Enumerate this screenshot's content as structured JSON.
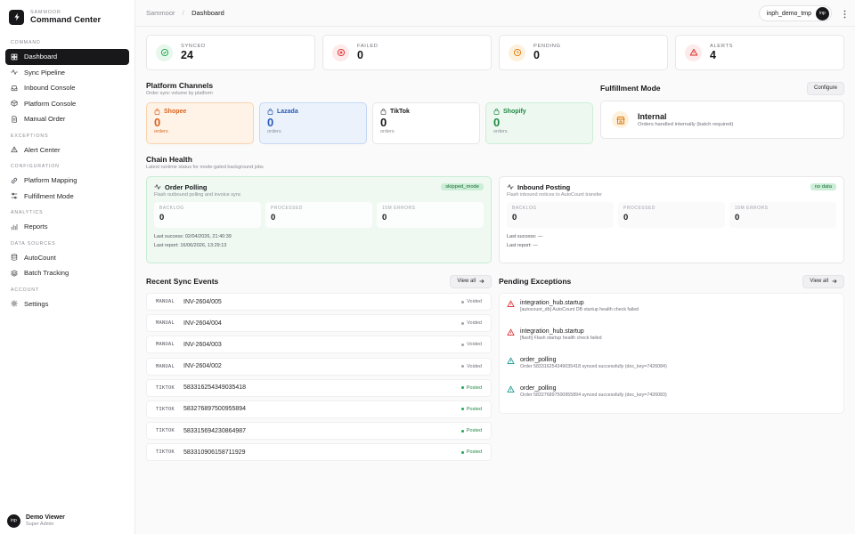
{
  "brand": {
    "small": "SAMMOOR",
    "name": "Command Center"
  },
  "nav": [
    {
      "section": "COMMAND",
      "items": [
        {
          "name": "dashboard",
          "label": "Dashboard",
          "icon": "grid-icon",
          "active": true
        },
        {
          "name": "sync-pipeline",
          "label": "Sync Pipeline",
          "icon": "pulse-icon"
        },
        {
          "name": "inbound-console",
          "label": "Inbound Console",
          "icon": "inbox-icon"
        },
        {
          "name": "platform-console",
          "label": "Platform Console",
          "icon": "box-icon"
        },
        {
          "name": "manual-order",
          "label": "Manual Order",
          "icon": "document-icon"
        }
      ]
    },
    {
      "section": "EXCEPTIONS",
      "items": [
        {
          "name": "alert-center",
          "label": "Alert Center",
          "icon": "warning-icon"
        }
      ]
    },
    {
      "section": "CONFIGURATION",
      "items": [
        {
          "name": "platform-mapping",
          "label": "Platform Mapping",
          "icon": "link-icon"
        },
        {
          "name": "fulfillment-mode",
          "label": "Fulfillment Mode",
          "icon": "sliders-icon"
        }
      ]
    },
    {
      "section": "ANALYTICS",
      "items": [
        {
          "name": "reports",
          "label": "Reports",
          "icon": "chart-icon"
        }
      ]
    },
    {
      "section": "DATA SOURCES",
      "items": [
        {
          "name": "autocount",
          "label": "AutoCount",
          "icon": "database-icon"
        },
        {
          "name": "batch-tracking",
          "label": "Batch Tracking",
          "icon": "layers-icon"
        }
      ]
    },
    {
      "section": "ACCOUNT",
      "items": [
        {
          "name": "settings",
          "label": "Settings",
          "icon": "gear-icon"
        }
      ]
    }
  ],
  "user": {
    "initials": "inp",
    "name": "Demo Viewer",
    "role": "Super Admin"
  },
  "topbar": {
    "root": "Sammoor",
    "separator": "/",
    "current": "Dashboard",
    "tenant": "inph_demo_tmp",
    "tenant_initials": "inp"
  },
  "stats": [
    {
      "label": "SYNCED",
      "value": "24",
      "color": "#16a34a",
      "bg": "#e7f7ec",
      "icon": "check-circle-icon"
    },
    {
      "label": "FAILED",
      "value": "0",
      "color": "#dc2626",
      "bg": "#fdeaea",
      "icon": "x-circle-icon"
    },
    {
      "label": "PENDING",
      "value": "0",
      "color": "#d97706",
      "bg": "#fdf1dd",
      "icon": "clock-icon"
    },
    {
      "label": "ALERTS",
      "value": "4",
      "color": "#dc2626",
      "bg": "#fdeaea",
      "icon": "warning-icon"
    }
  ],
  "platform_channels": {
    "title": "Platform Channels",
    "subtitle": "Order sync volume by platform",
    "items": [
      {
        "key": "shopee",
        "name": "Shopee",
        "count": "0",
        "unit": "orders"
      },
      {
        "key": "lazada",
        "name": "Lazada",
        "count": "0",
        "unit": "orders"
      },
      {
        "key": "tiktok",
        "name": "TikTok",
        "count": "0",
        "unit": "orders"
      },
      {
        "key": "shopify",
        "name": "Shopify",
        "count": "0",
        "unit": "orders"
      }
    ]
  },
  "fulfillment": {
    "title": "Fulfillment Mode",
    "configure_label": "Configure",
    "mode": "Internal",
    "description": "Orders handled internally (batch required)"
  },
  "chain_health": {
    "title": "Chain Health",
    "subtitle": "Latest runtime status for mode-gated background jobs",
    "cards": [
      {
        "title": "Order Polling",
        "badge": "skipped_mode",
        "subtitle": "Flash outbound polling and invoice sync",
        "metrics": [
          {
            "label": "BACKLOG",
            "value": "0"
          },
          {
            "label": "PROCESSED",
            "value": "0"
          },
          {
            "label": "15M ERRORS",
            "value": "0"
          }
        ],
        "last_success": "Last success: 02/04/2026, 21:40:39",
        "last_report": "Last report: 16/06/2026, 13:29:13"
      },
      {
        "title": "Inbound Posting",
        "badge": "no data",
        "subtitle": "Flash inbound notices to AutoCount transfer",
        "metrics": [
          {
            "label": "BACKLOG",
            "value": "0"
          },
          {
            "label": "PROCESSED",
            "value": "0"
          },
          {
            "label": "15M ERRORS",
            "value": "0"
          }
        ],
        "last_success": "Last success: —",
        "last_report": "Last report: —"
      }
    ]
  },
  "recent_events": {
    "title": "Recent Sync Events",
    "view_all": "View all",
    "rows": [
      {
        "source": "MANUAL",
        "ref": "INV-2604/005",
        "status": "Voided",
        "state": "voided"
      },
      {
        "source": "MANUAL",
        "ref": "INV-2604/004",
        "status": "Voided",
        "state": "voided"
      },
      {
        "source": "MANUAL",
        "ref": "INV-2604/003",
        "status": "Voided",
        "state": "voided"
      },
      {
        "source": "MANUAL",
        "ref": "INV-2604/002",
        "status": "Voided",
        "state": "voided"
      },
      {
        "source": "TIKTOK",
        "ref": "583316254349035418",
        "status": "Posted",
        "state": "posted"
      },
      {
        "source": "TIKTOK",
        "ref": "583276897500955894",
        "status": "Posted",
        "state": "posted"
      },
      {
        "source": "TIKTOK",
        "ref": "583315694230864987",
        "status": "Posted",
        "state": "posted"
      },
      {
        "source": "TIKTOK",
        "ref": "583310906158711929",
        "status": "Posted",
        "state": "posted"
      }
    ]
  },
  "pending_exceptions": {
    "title": "Pending Exceptions",
    "view_all": "View all",
    "rows": [
      {
        "title": "integration_hub.startup",
        "detail": "[autocount_db] AutoCount DB startup health check failed",
        "level": "error"
      },
      {
        "title": "integration_hub.startup",
        "detail": "[flash] Flash startup health check failed",
        "level": "error"
      },
      {
        "title": "order_polling",
        "detail": "Order 583316254349035418 synced successfully (doc_key=7426084)",
        "level": "info"
      },
      {
        "title": "order_polling",
        "detail": "Order 583276897500955894 synced successfully (doc_key=7426083)",
        "level": "info"
      }
    ]
  }
}
